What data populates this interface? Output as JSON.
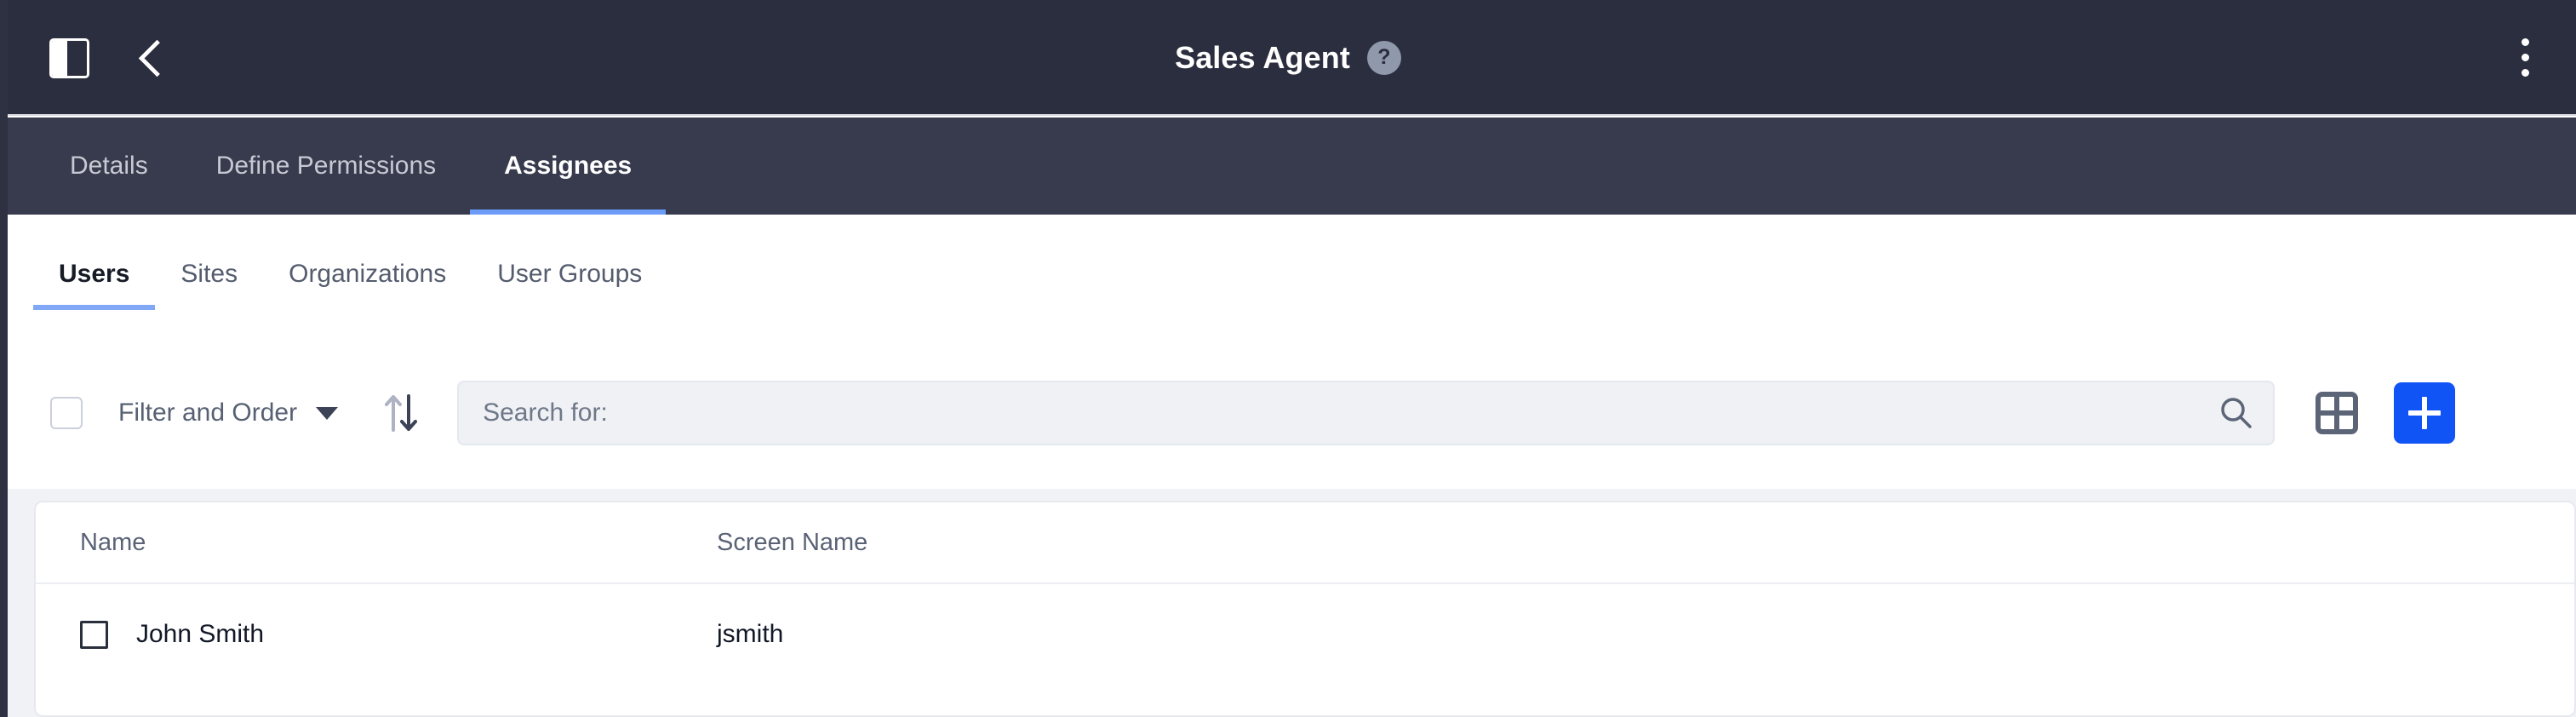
{
  "colors": {
    "header_bg": "#2b2e3e",
    "tabbar_bg": "#373b4d",
    "accent_blue": "#1154f5",
    "tab_underline": "#6d9cf8",
    "subtab_underline": "#81a8f7",
    "content_bg": "#f1f2f6",
    "search_bg": "#eff1f5"
  },
  "header": {
    "title": "Sales Agent",
    "help_label": "?",
    "panel_toggle_icon": "side-panel-toggle-icon",
    "back_icon": "chevron-left-icon",
    "overflow_icon": "kebab-vertical-icon"
  },
  "tabs": [
    {
      "label": "Details",
      "active": false
    },
    {
      "label": "Define Permissions",
      "active": false
    },
    {
      "label": "Assignees",
      "active": true
    }
  ],
  "subtabs": [
    {
      "label": "Users",
      "active": true
    },
    {
      "label": "Sites",
      "active": false
    },
    {
      "label": "Organizations",
      "active": false
    },
    {
      "label": "User Groups",
      "active": false
    }
  ],
  "toolbar": {
    "select_all_checked": false,
    "filter_label": "Filter and Order",
    "caret_icon": "chevron-down-icon",
    "sort_icon": "sort-arrows-icon",
    "search_value": "",
    "search_placeholder": "Search for:",
    "search_icon": "magnifier-icon",
    "grid_view_icon": "grid-view-icon",
    "add_icon": "plus-icon"
  },
  "table": {
    "columns": [
      {
        "key": "name",
        "label": "Name"
      },
      {
        "key": "screen_name",
        "label": "Screen Name"
      }
    ],
    "rows": [
      {
        "checked": false,
        "name": "John Smith",
        "screen_name": "jsmith"
      }
    ]
  }
}
